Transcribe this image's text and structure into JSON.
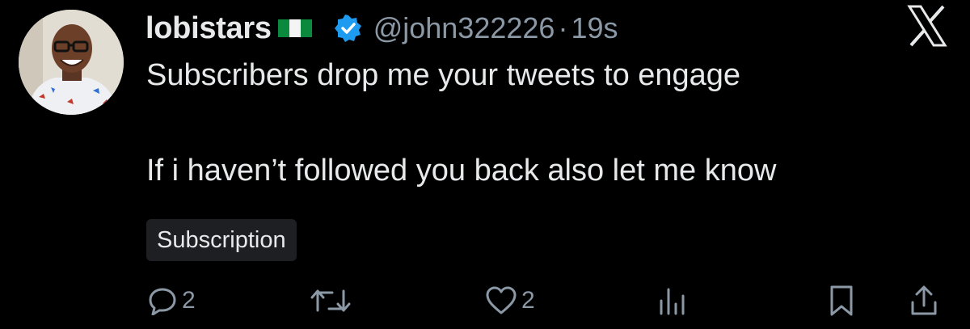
{
  "tweet": {
    "display_name": "lobistars",
    "flag": "nigeria-flag",
    "verified": "verified-badge",
    "handle": "@john322226",
    "separator": "·",
    "time": "19s",
    "text_line1": "Subscribers drop me your tweets to engage",
    "text_line2": "If i haven’t followed you back also let me know",
    "tag": "Subscription"
  },
  "actions": {
    "reply_count": "2",
    "like_count": "2"
  },
  "colors": {
    "background": "#000000",
    "text": "#e7e9ea",
    "muted": "#8b98a5",
    "verified_blue": "#1d9bf0",
    "tag_bg": "#1e1f22"
  },
  "icons": [
    "x-logo-icon",
    "reply-icon",
    "retweet-icon",
    "like-icon",
    "views-icon",
    "bookmark-icon",
    "share-icon"
  ]
}
